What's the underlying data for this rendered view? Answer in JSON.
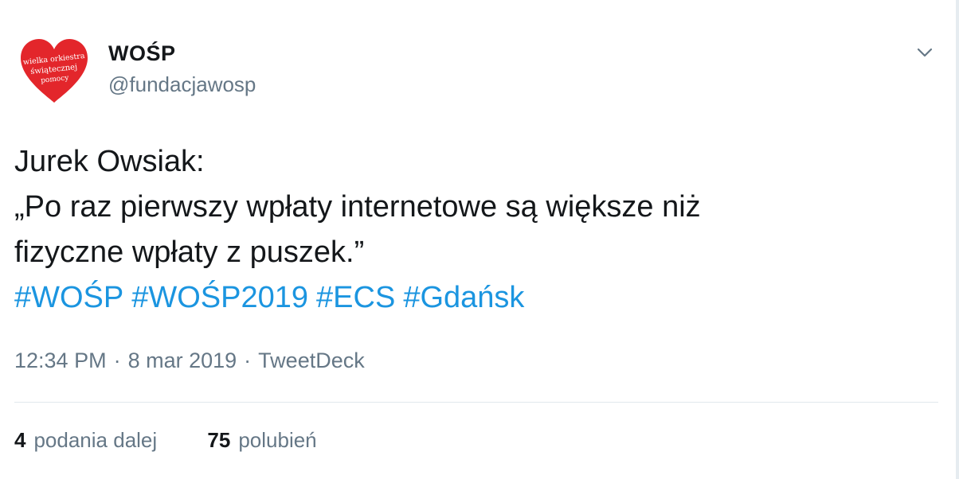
{
  "tweet": {
    "author": {
      "display_name": "WOŚP",
      "handle": "@fundacjawosp",
      "avatar_text": [
        "wielka orkiestra",
        "świątecznej",
        "pomocy"
      ],
      "avatar_color": "#e3262b"
    },
    "text_lines": [
      "Jurek Owsiak:",
      "„Po raz pierwszy wpłaty internetowe są większe niż",
      "fizyczne wpłaty z puszek.”"
    ],
    "hashtags": [
      "#WOŚP",
      "#WOŚP2019",
      "#ECS",
      "#Gdańsk"
    ],
    "hashtag_color": "#1b95e0",
    "time": "12:34 PM",
    "date": "8 mar 2019",
    "separator": "·",
    "source": "TweetDeck",
    "retweets": {
      "count": "4",
      "label": "podania dalej"
    },
    "likes": {
      "count": "75",
      "label": "polubień"
    },
    "menu_icon": "chevron-down-icon"
  }
}
